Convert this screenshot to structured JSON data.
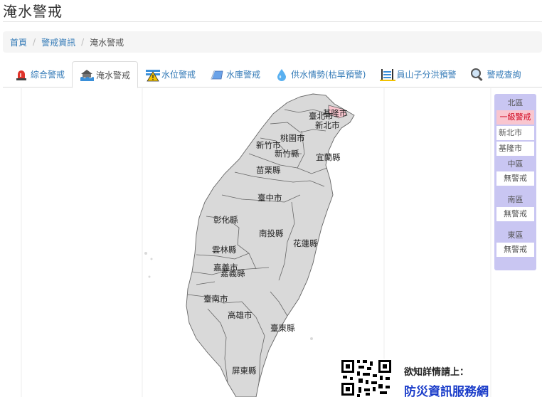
{
  "page_title": "淹水警戒",
  "breadcrumb": {
    "home": "首頁",
    "section": "警戒資訊",
    "current": "淹水警戒"
  },
  "tabs": [
    {
      "label": "綜合警戒",
      "icon": "siren-icon"
    },
    {
      "label": "淹水警戒",
      "icon": "flood-icon",
      "active": true
    },
    {
      "label": "水位警戒",
      "icon": "water-level-icon"
    },
    {
      "label": "水庫警戒",
      "icon": "reservoir-icon"
    },
    {
      "label": "供水情勢(枯旱預警)",
      "icon": "water-drop-icon"
    },
    {
      "label": "員山子分洪預警",
      "icon": "flood-diversion-icon"
    },
    {
      "label": "警戒查詢",
      "icon": "magnifier-icon"
    }
  ],
  "map_labels": {
    "keelung": "基隆市",
    "taipei": "臺北市",
    "new_taipei": "新北市",
    "taoyuan": "桃園市",
    "hsinchu_city": "新竹市",
    "hsinchu_county": "新竹縣",
    "yilan": "宜蘭縣",
    "miaoli": "苗栗縣",
    "taichung": "臺中市",
    "changhua": "彰化縣",
    "nantou": "南投縣",
    "hualien": "花蓮縣",
    "yunlin": "雲林縣",
    "chiayi_city": "嘉義市",
    "chiayi_county": "嘉義縣",
    "tainan": "臺南市",
    "kaohsiung": "高雄市",
    "taitung": "臺東縣",
    "pingtung": "屏東縣"
  },
  "legend": {
    "north": {
      "title": "北區",
      "level": "一級警戒",
      "items": [
        "新北市",
        "基隆市"
      ]
    },
    "central": {
      "title": "中區",
      "status": "無警戒"
    },
    "south": {
      "title": "南區",
      "status": "無警戒"
    },
    "east": {
      "title": "東區",
      "status": "無警戒"
    }
  },
  "footer": {
    "info_text": "欲知詳情請上：",
    "link_text": "防災資訊服務網"
  },
  "colors": {
    "map_fill": "#d9d9d9",
    "map_border": "#666666",
    "alert_fill": "#f9c6cf",
    "alert_text": "#d0021b",
    "legend_bg": "#c9c6f2",
    "link": "#337ab7"
  }
}
